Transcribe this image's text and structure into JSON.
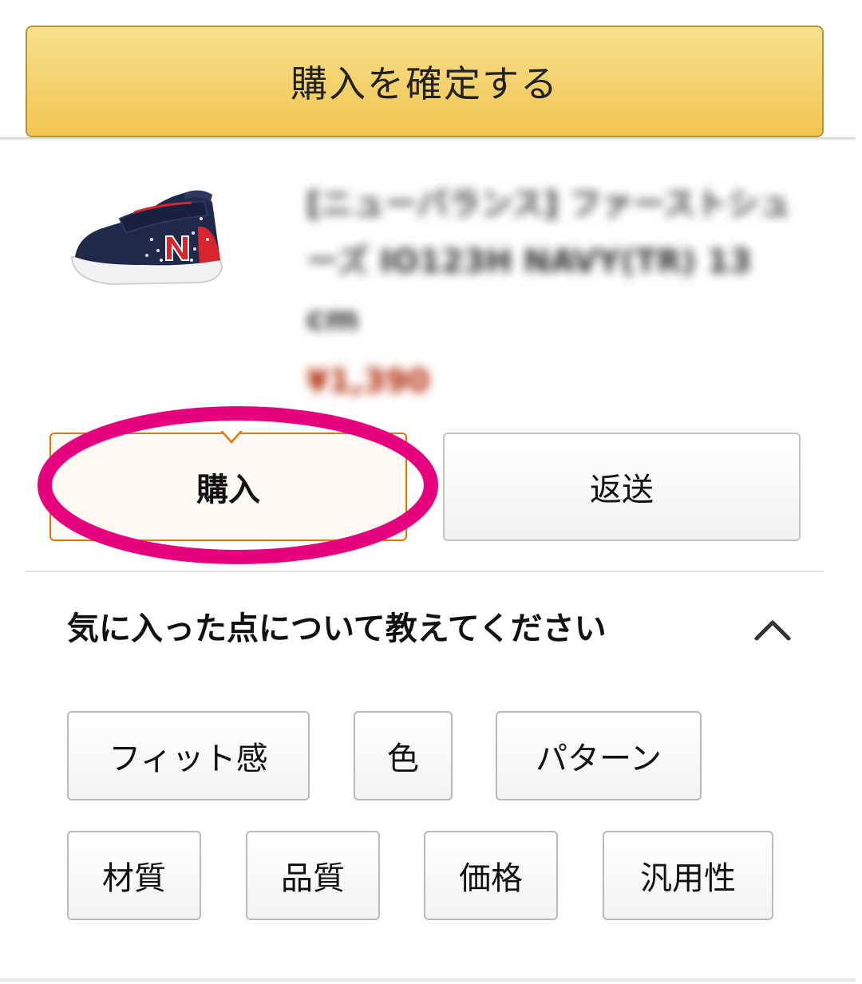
{
  "confirm": {
    "label": "購入を確定する",
    "color": "#f1c550"
  },
  "product": {
    "title": "[ニューバランス] ファーストシューズ IO123H NAVY(TR) 13 cm",
    "price": "¥1,390",
    "image_icon": "sneaker-icon"
  },
  "choices": {
    "purchase_label": "購入",
    "return_label": "返送",
    "selected": "purchase",
    "highlight_color": "#e6007e",
    "selected_border_color": "#e77600"
  },
  "feedback": {
    "heading": "気に入った点について教えてください",
    "collapse_icon": "chevron-up-icon",
    "chips": [
      {
        "label": "フィット感"
      },
      {
        "label": "色"
      },
      {
        "label": "パターン"
      },
      {
        "label": "材質"
      },
      {
        "label": "品質"
      },
      {
        "label": "価格"
      },
      {
        "label": "汎用性"
      }
    ]
  }
}
